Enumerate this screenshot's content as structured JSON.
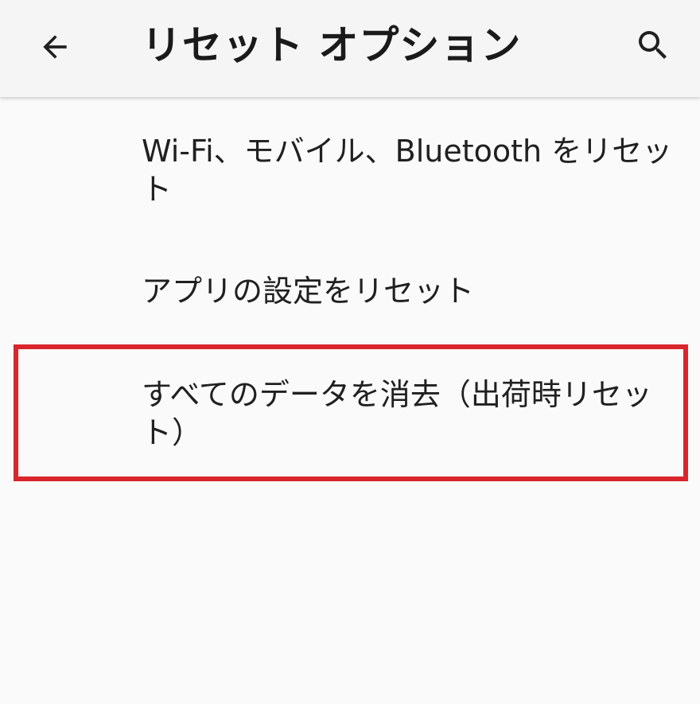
{
  "app_bar": {
    "title": "リセット オプション",
    "back_icon": "arrow-left-icon",
    "search_icon": "search-icon"
  },
  "options": [
    {
      "label": "Wi-Fi、モバイル、Bluetooth をリセット"
    },
    {
      "label": "アプリの設定をリセット"
    },
    {
      "label": "すべてのデータを消去（出荷時リセット）"
    }
  ],
  "colors": {
    "background": "#fafafa",
    "app_bar": "#f5f5f5",
    "highlight": "#d9262c"
  }
}
